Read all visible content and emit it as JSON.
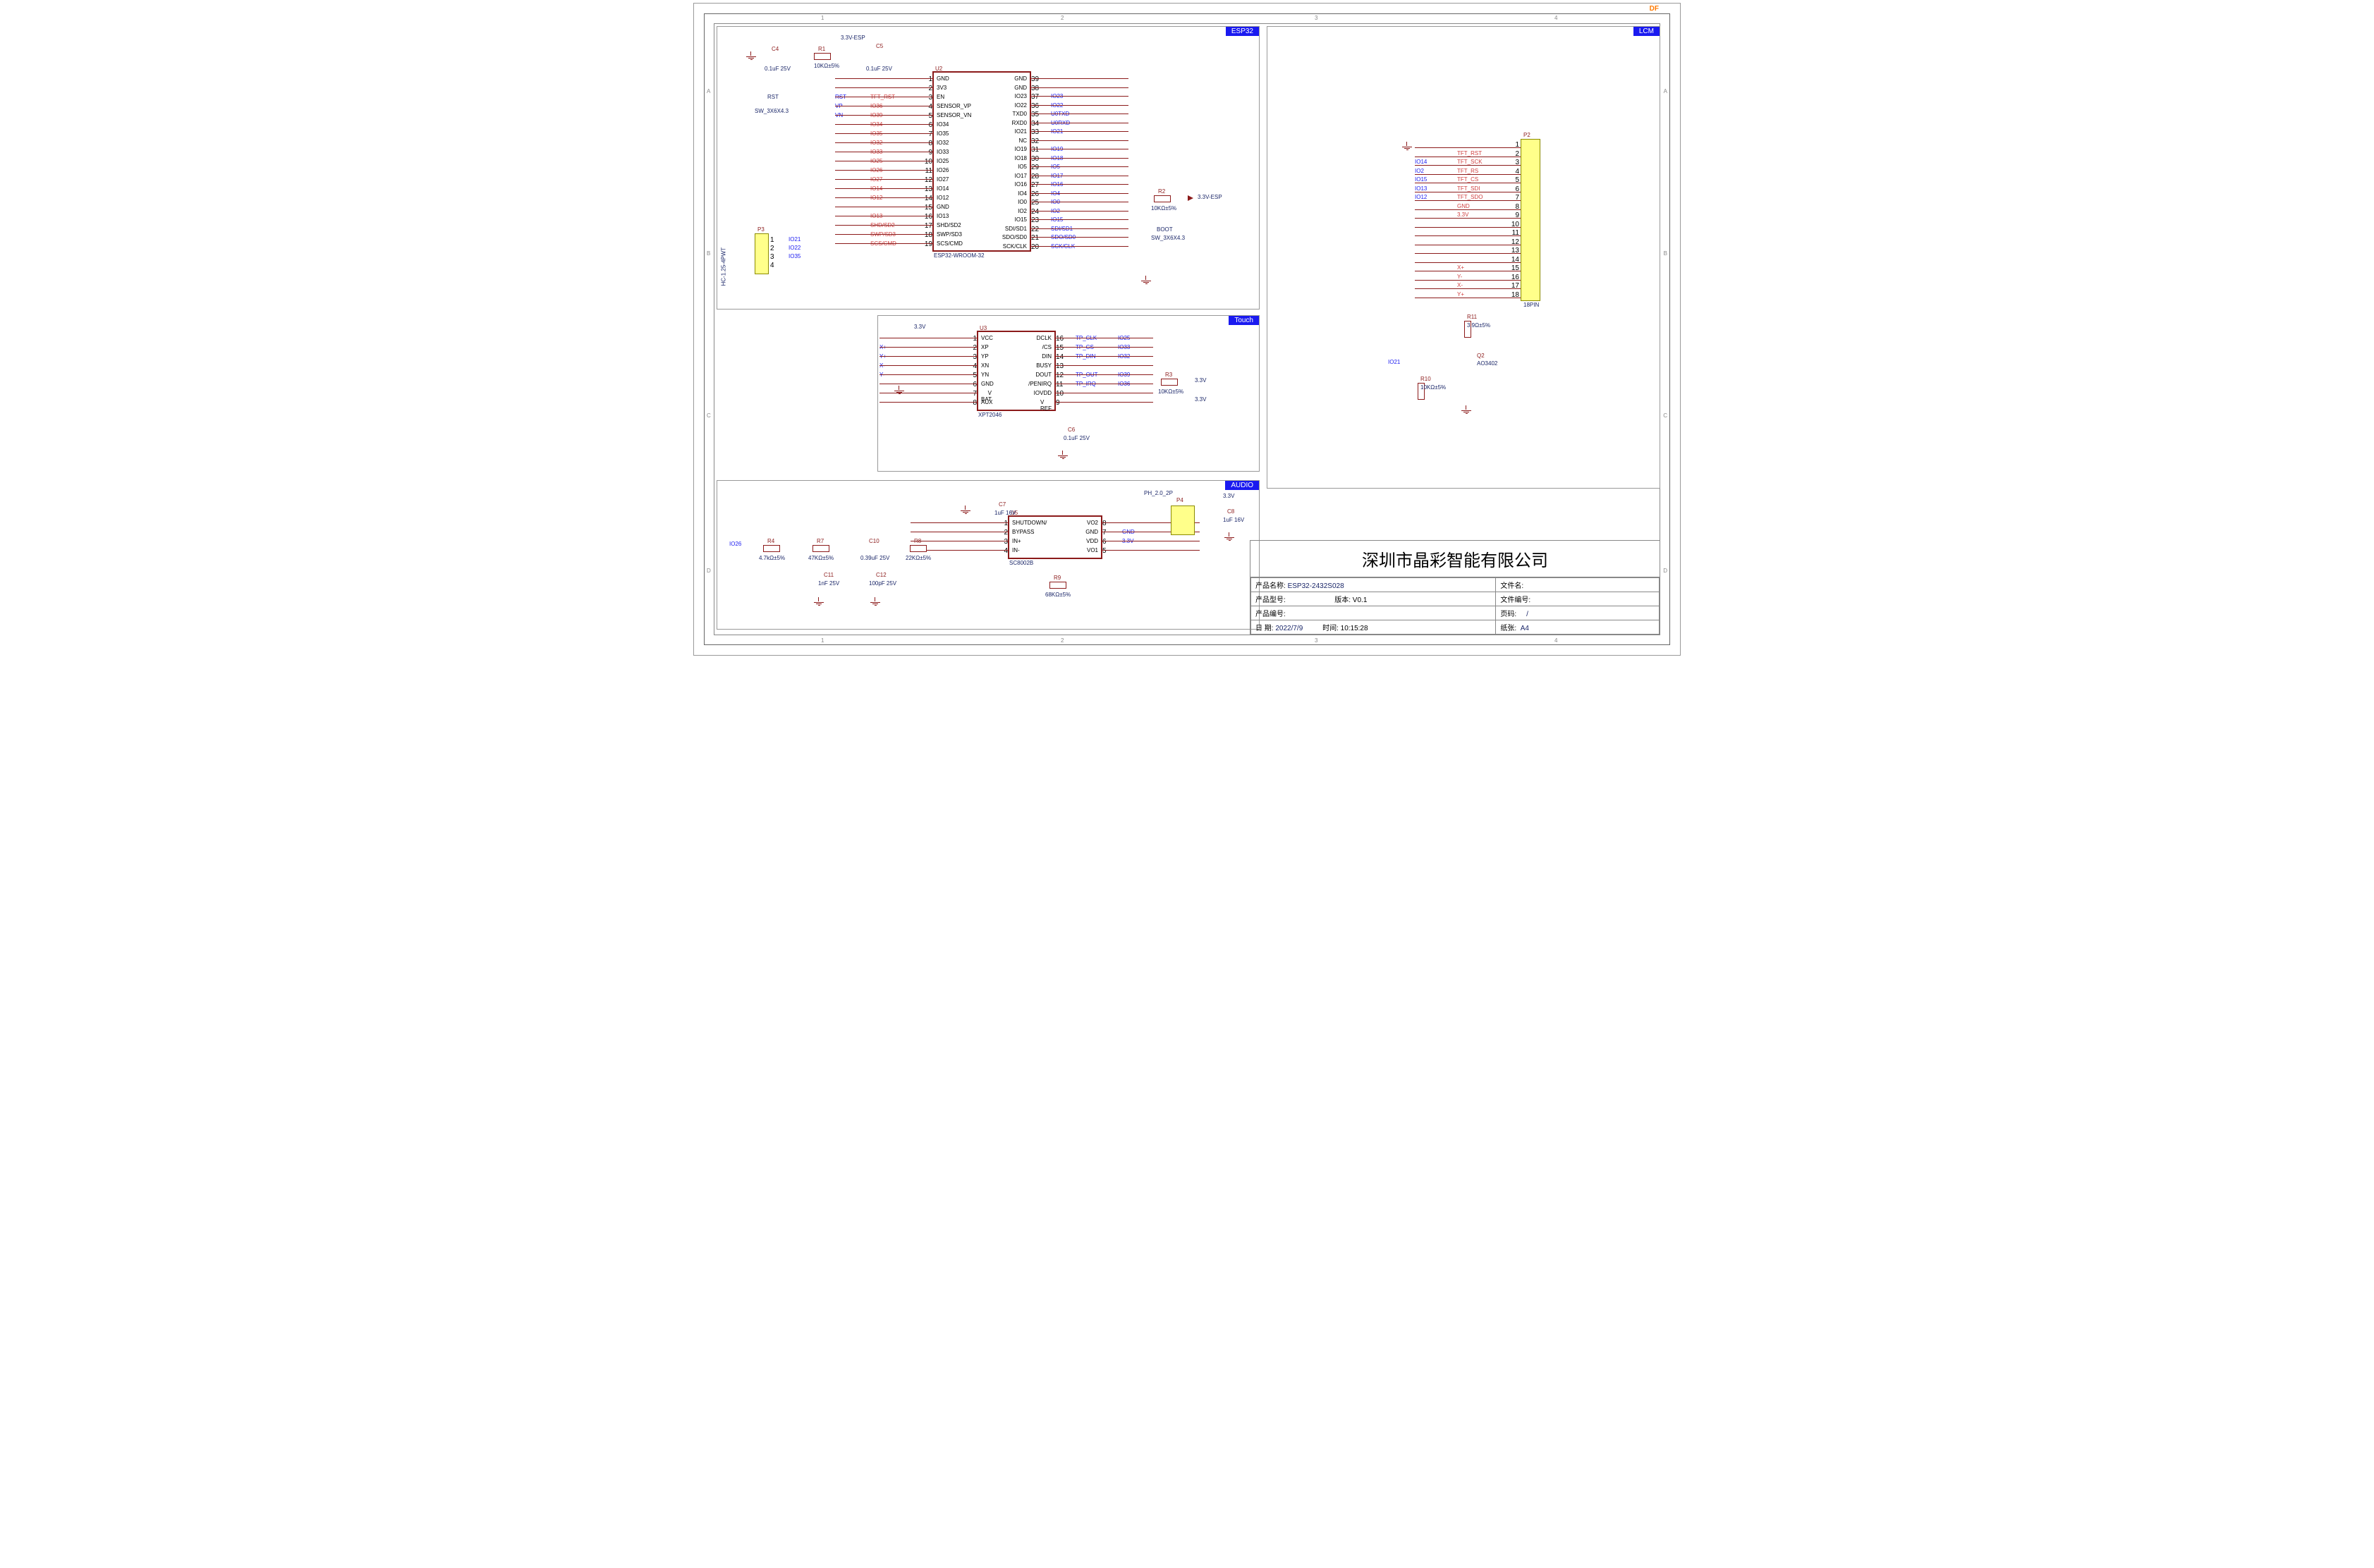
{
  "sheet": {
    "zone_cols": [
      "1",
      "2",
      "3",
      "4"
    ],
    "zone_rows": [
      "A",
      "B",
      "C",
      "D"
    ],
    "top_right": "DF"
  },
  "blocks": {
    "esp32": {
      "tag": "ESP32"
    },
    "touch": {
      "tag": "Touch"
    },
    "audio": {
      "tag": "AUDIO"
    },
    "lcm": {
      "tag": "LCM"
    }
  },
  "u2": {
    "ref": "U2",
    "name": "ESP32-WROOM-32",
    "left": [
      {
        "n": "1",
        "f": "GND",
        "net": ""
      },
      {
        "n": "2",
        "f": "3V3",
        "net": ""
      },
      {
        "n": "3",
        "f": "EN",
        "net": "RST",
        "alt": "TFT_RST"
      },
      {
        "n": "4",
        "f": "SENSOR_VP",
        "net": "VP",
        "alt": "IO36"
      },
      {
        "n": "5",
        "f": "SENSOR_VN",
        "net": "VN",
        "alt": "IO39"
      },
      {
        "n": "6",
        "f": "IO34",
        "net": "",
        "alt": "IO34"
      },
      {
        "n": "7",
        "f": "IO35",
        "net": "",
        "alt": "IO35"
      },
      {
        "n": "8",
        "f": "IO32",
        "net": "",
        "alt": "IO32"
      },
      {
        "n": "9",
        "f": "IO33",
        "net": "",
        "alt": "IO33"
      },
      {
        "n": "10",
        "f": "IO25",
        "net": "",
        "alt": "IO25"
      },
      {
        "n": "11",
        "f": "IO26",
        "net": "",
        "alt": "IO26"
      },
      {
        "n": "12",
        "f": "IO27",
        "net": "",
        "alt": "IO27"
      },
      {
        "n": "13",
        "f": "IO14",
        "net": "",
        "alt": "IO14"
      },
      {
        "n": "14",
        "f": "IO12",
        "net": "",
        "alt": "IO12"
      },
      {
        "n": "15",
        "f": "GND",
        "net": ""
      },
      {
        "n": "16",
        "f": "IO13",
        "net": "",
        "alt": "IO13"
      },
      {
        "n": "17",
        "f": "SHD/SD2",
        "net": "",
        "alt": "SHD/SD2"
      },
      {
        "n": "18",
        "f": "SWP/SD3",
        "net": "",
        "alt": "SWP/SD3"
      },
      {
        "n": "19",
        "f": "SCS/CMD",
        "net": "",
        "alt": "SCS/CMD"
      }
    ],
    "right": [
      {
        "n": "39",
        "f": "GND"
      },
      {
        "n": "38",
        "f": "GND"
      },
      {
        "n": "37",
        "f": "IO23",
        "net": "IO23"
      },
      {
        "n": "36",
        "f": "IO22",
        "net": "IO22"
      },
      {
        "n": "35",
        "f": "TXD0",
        "net": "U0TXD"
      },
      {
        "n": "34",
        "f": "RXD0",
        "net": "U0RXD"
      },
      {
        "n": "33",
        "f": "IO21",
        "net": "IO21"
      },
      {
        "n": "32",
        "f": "NC"
      },
      {
        "n": "31",
        "f": "IO19",
        "net": "IO19"
      },
      {
        "n": "30",
        "f": "IO18",
        "net": "IO18"
      },
      {
        "n": "29",
        "f": "IO5",
        "net": "IO5"
      },
      {
        "n": "28",
        "f": "IO17",
        "net": "IO17"
      },
      {
        "n": "27",
        "f": "IO16",
        "net": "IO16"
      },
      {
        "n": "26",
        "f": "IO4",
        "net": "IO4"
      },
      {
        "n": "25",
        "f": "IO0",
        "net": "IO0"
      },
      {
        "n": "24",
        "f": "IO2",
        "net": "IO2"
      },
      {
        "n": "23",
        "f": "IO15",
        "net": "IO15"
      },
      {
        "n": "22",
        "f": "SDI/SD1",
        "net": "SDI/SD1"
      },
      {
        "n": "21",
        "f": "SDO/SD0",
        "net": "SDO/SD0"
      },
      {
        "n": "20",
        "f": "SCK/CLK",
        "net": "SCK/CLK"
      }
    ]
  },
  "u3": {
    "ref": "U3",
    "name": "XPT2046",
    "left": [
      {
        "n": "1",
        "f": "VCC"
      },
      {
        "n": "2",
        "f": "XP",
        "net": "X+"
      },
      {
        "n": "3",
        "f": "YP",
        "net": "Y+"
      },
      {
        "n": "4",
        "f": "XN",
        "net": "X-"
      },
      {
        "n": "5",
        "f": "YN",
        "net": "Y-"
      },
      {
        "n": "6",
        "f": "GND"
      },
      {
        "n": "7",
        "f": "V BAT"
      },
      {
        "n": "8",
        "f": "AUX"
      }
    ],
    "right": [
      {
        "n": "16",
        "f": "DCLK",
        "net": "TP_CLK",
        "io": "IO25"
      },
      {
        "n": "15",
        "f": "/CS",
        "net": "TP_CS",
        "io": "IO33"
      },
      {
        "n": "14",
        "f": "DIN",
        "net": "TP_DIN",
        "io": "IO32"
      },
      {
        "n": "13",
        "f": "BUSY"
      },
      {
        "n": "12",
        "f": "DOUT",
        "net": "TP_OUT",
        "io": "IO39"
      },
      {
        "n": "11",
        "f": "/PENIRQ",
        "net": "TP_IRQ",
        "io": "IO36"
      },
      {
        "n": "10",
        "f": "IOVDD"
      },
      {
        "n": "9",
        "f": "V REF"
      }
    ]
  },
  "u5": {
    "ref": "U5",
    "name": "SC8002B",
    "left": [
      {
        "n": "1",
        "f": "SHUTDOWN/"
      },
      {
        "n": "2",
        "f": "BYPASS"
      },
      {
        "n": "3",
        "f": "IN+"
      },
      {
        "n": "4",
        "f": "IN-"
      }
    ],
    "right": [
      {
        "n": "8",
        "f": "VO2"
      },
      {
        "n": "7",
        "f": "GND",
        "net": "GND"
      },
      {
        "n": "6",
        "f": "VDD",
        "net": "3.3V"
      },
      {
        "n": "5",
        "f": "VO1"
      }
    ]
  },
  "p2": {
    "ref": "P2",
    "name": "18PIN",
    "pins": [
      {
        "n": "1",
        "net": ""
      },
      {
        "n": "2",
        "net": "TFT_RST"
      },
      {
        "n": "3",
        "net": "TFT_SCK",
        "io": "IO14"
      },
      {
        "n": "4",
        "net": "TFT_RS",
        "io": "IO2"
      },
      {
        "n": "5",
        "net": "TFT_CS",
        "io": "IO15"
      },
      {
        "n": "6",
        "net": "TFT_SDI",
        "io": "IO13"
      },
      {
        "n": "7",
        "net": "TFT_SDO",
        "io": "IO12"
      },
      {
        "n": "8",
        "net": "GND"
      },
      {
        "n": "9",
        "net": "3.3V"
      },
      {
        "n": "10",
        "net": ""
      },
      {
        "n": "11",
        "net": ""
      },
      {
        "n": "12",
        "net": ""
      },
      {
        "n": "13",
        "net": ""
      },
      {
        "n": "14",
        "net": ""
      },
      {
        "n": "15",
        "net": "X+"
      },
      {
        "n": "16",
        "net": "Y-"
      },
      {
        "n": "17",
        "net": "X-"
      },
      {
        "n": "18",
        "net": "Y+"
      }
    ]
  },
  "p3": {
    "ref": "P3",
    "name": "HC-1.25-4PWT",
    "pins": [
      {
        "n": "1",
        "net": "IO21"
      },
      {
        "n": "2",
        "net": "IO22"
      },
      {
        "n": "3",
        "net": "IO35"
      },
      {
        "n": "4",
        "net": ""
      }
    ]
  },
  "p4": {
    "ref": "P4",
    "name": "PH_2.0_2P"
  },
  "parts": {
    "C4": {
      "ref": "C4",
      "val": "0.1uF 25V"
    },
    "C5": {
      "ref": "C5",
      "val": "0.1uF 25V"
    },
    "C6": {
      "ref": "C6",
      "val": "0.1uF 25V"
    },
    "C7": {
      "ref": "C7",
      "val": "1uF 16V"
    },
    "C8": {
      "ref": "C8",
      "val": "1uF 16V"
    },
    "C10": {
      "ref": "C10",
      "val": "0.39uF 25V"
    },
    "C11": {
      "ref": "C11",
      "val": "1nF 25V"
    },
    "C12": {
      "ref": "C12",
      "val": "100pF 25V"
    },
    "R1": {
      "ref": "R1",
      "val": "10KΩ±5%"
    },
    "R2": {
      "ref": "R2",
      "val": "10KΩ±5%"
    },
    "R3": {
      "ref": "R3",
      "val": "10KΩ±5%"
    },
    "R4": {
      "ref": "R4",
      "val": "4.7kΩ±5%"
    },
    "R7": {
      "ref": "R7",
      "val": "47KΩ±5%"
    },
    "R8": {
      "ref": "R8",
      "val": "22KΩ±5%"
    },
    "R9": {
      "ref": "R9",
      "val": "68KΩ±5%"
    },
    "R10": {
      "ref": "R10",
      "val": "10KΩ±5%"
    },
    "R11": {
      "ref": "R11",
      "val": "3.9Ω±5%"
    },
    "Q2": {
      "ref": "Q2",
      "val": "AO3402"
    },
    "RST": {
      "ref": "RST",
      "val": "SW_3X6X4.3"
    },
    "BOOT": {
      "ref": "BOOT",
      "val": "SW_3X6X4.3"
    }
  },
  "nets": {
    "v33esp": "3.3V-ESP",
    "v33": "3.3V",
    "io26": "IO26",
    "io21": "IO21"
  },
  "title": {
    "company": "深圳市晶彩智能有限公司",
    "rows": [
      {
        "l": "产品名称:",
        "v": "ESP32-2432S028",
        "l2": "文件名:",
        "v2": ""
      },
      {
        "l": "产品型号:",
        "v": "",
        "l2": "版本: V0.1",
        "v2": "",
        "l3": "文件编号:",
        "v3": ""
      },
      {
        "l": "产品编号:",
        "v": "",
        "l2": "",
        "v2": "",
        "l3": "页码:",
        "v3": "/"
      },
      {
        "l": "日    期:",
        "v": "2022/7/9",
        "l2": "时间: 10:15:28",
        "v2": "",
        "l3": "纸张:",
        "v3": "A4"
      }
    ]
  }
}
